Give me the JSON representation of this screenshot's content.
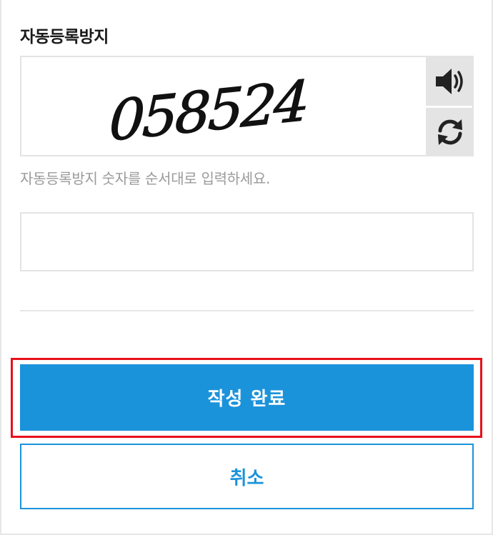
{
  "captcha": {
    "title": "자동등록방지",
    "image_text": "058524",
    "audio_icon": "speaker-icon",
    "refresh_icon": "refresh-icon",
    "hint": "자동등록방지 숫자를 순서대로 입력하세요.",
    "input_value": ""
  },
  "actions": {
    "submit_label": "작성 완료",
    "cancel_label": "취소"
  },
  "colors": {
    "primary": "#1b93db",
    "highlight": "#e8101b",
    "border": "#e3e3e3",
    "hint_text": "#9a9a9a",
    "icon_bg": "#e4e4e4"
  }
}
